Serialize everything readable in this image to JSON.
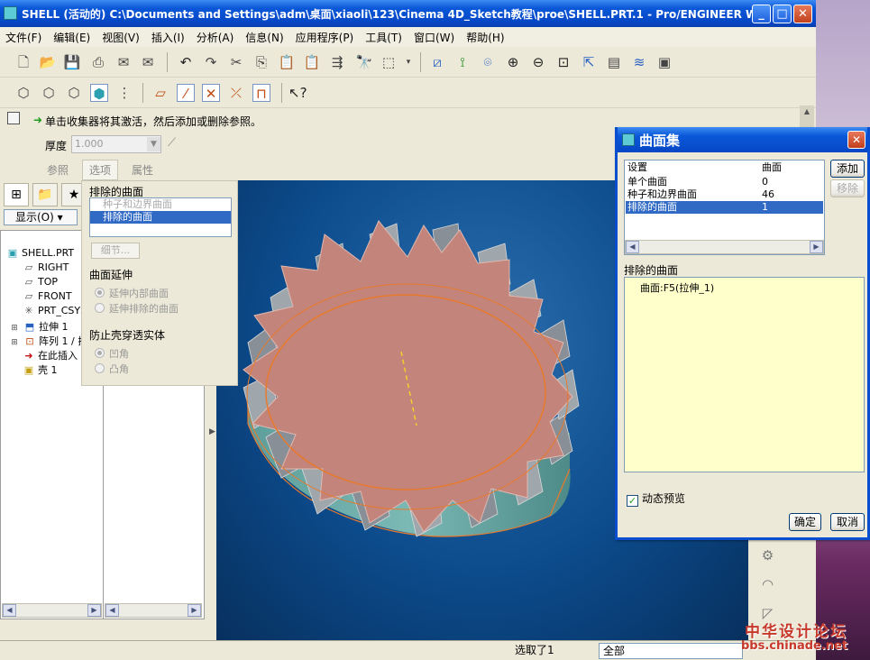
{
  "window": {
    "title": "SHELL (活动的) C:\\Documents and Settings\\adm\\桌面\\xiaoli\\123\\Cinema 4D_Sketch教程\\proe\\SHELL.PRT.1 - Pro/ENGINEER W...",
    "min": "_",
    "max": "□",
    "close": "✕"
  },
  "menu": [
    "文件(F)",
    "编辑(E)",
    "视图(V)",
    "插入(I)",
    "分析(A)",
    "信息(N)",
    "应用程序(P)",
    "工具(T)",
    "窗口(W)",
    "帮助(H)"
  ],
  "dashboard": {
    "prompt": "单击收集器将其激活，然后添加或删除参照。",
    "thickness_label": "厚度",
    "thickness_value": "1.000",
    "tabs": {
      "reference": "参照",
      "options": "选项",
      "properties": "属性"
    }
  },
  "model_tree": {
    "show_label": "显示(O) ▾",
    "items": [
      "SHELL.PRT",
      "RIGHT",
      "TOP",
      "FRONT",
      "PRT_CSYS",
      "拉伸 1",
      "阵列 1 / 拉",
      "在此插入",
      "壳 1"
    ]
  },
  "options_panel": {
    "excluded_label": "排除的曲面",
    "list": [
      "种子和边界曲面",
      "排除的曲面"
    ],
    "details_btn": "细节...",
    "extend_label": "曲面延伸",
    "extend_opts": [
      "延伸内部曲面",
      "延伸排除的曲面"
    ],
    "prevent_label": "防止壳穿透实体",
    "prevent_opts": [
      "凹角",
      "凸角"
    ]
  },
  "dialog": {
    "title": "曲面集",
    "col1": "设置",
    "col2": "曲面",
    "rows": [
      {
        "name": "单个曲面",
        "count": "0"
      },
      {
        "name": "种子和边界曲面",
        "count": "46"
      },
      {
        "name": "排除的曲面",
        "count": "1"
      }
    ],
    "add": "添加",
    "remove": "移除",
    "excluded_label": "排除的曲面",
    "excluded_item": "曲面:F5(拉伸_1)",
    "preview": "动态预览",
    "ok": "确定",
    "cancel": "取消"
  },
  "status": {
    "text": "选取了1",
    "filter": "全部"
  },
  "watermark": {
    "line1": "中华设计论坛",
    "line2": "bbs.chinade.net"
  }
}
